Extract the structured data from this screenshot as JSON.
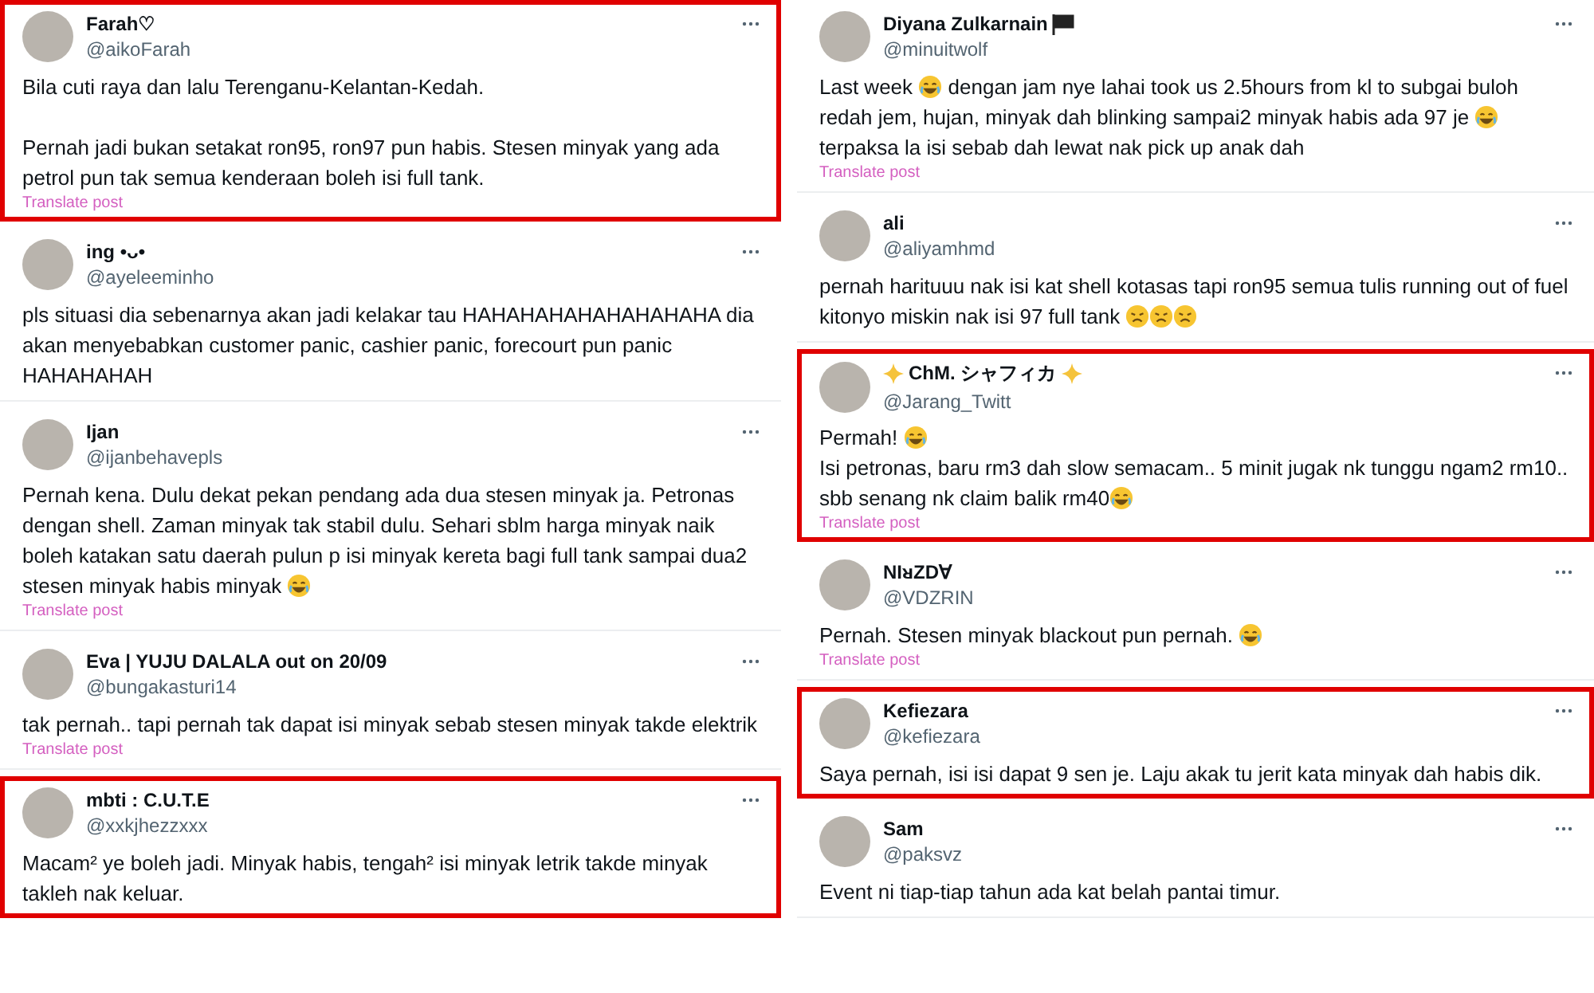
{
  "columns": [
    {
      "posts": [
        {
          "name": [
            {
              "kind": "text",
              "text": "Farah♡"
            }
          ],
          "handle": "@aikoFarah",
          "highlighted": true,
          "translate": "Translate post",
          "body": [
            {
              "kind": "text",
              "text": "Bila cuti raya dan lalu Terenganu-Kelantan-Kedah.\n\nPernah jadi bukan setakat ron95, ron97 pun habis. Stesen minyak yang ada petrol pun tak semua kenderaan boleh isi full tank."
            }
          ]
        },
        {
          "name": [
            {
              "kind": "text",
              "text": "ing •ᴗ•"
            }
          ],
          "handle": "@ayeleeminho",
          "highlighted": false,
          "body": [
            {
              "kind": "text",
              "text": "pls situasi dia sebenarnya akan jadi kelakar tau HAHAHAHAHAHAHAHAHA dia akan menyebabkan customer panic, cashier panic, forecourt pun panic HAHAHAHAH"
            }
          ]
        },
        {
          "name": [
            {
              "kind": "text",
              "text": "Ijan"
            }
          ],
          "handle": "@ijanbehavepls",
          "highlighted": false,
          "translate": "Translate post",
          "body": [
            {
              "kind": "text",
              "text": "Pernah kena. Dulu dekat pekan pendang ada dua stesen minyak ja. Petronas dengan shell. Zaman minyak tak stabil dulu. Sehari sblm harga minyak naik boleh katakan satu daerah pulun p isi minyak kereta bagi full tank sampai dua2 stesen minyak habis minyak "
            },
            {
              "kind": "rofl"
            }
          ]
        },
        {
          "name": [
            {
              "kind": "text",
              "text": "Eva | YUJU DALALA out on 20/09"
            }
          ],
          "handle": "@bungakasturi14",
          "highlighted": false,
          "translate": "Translate post",
          "body": [
            {
              "kind": "text",
              "text": "tak pernah.. tapi pernah tak dapat isi minyak sebab stesen minyak takde elektrik"
            }
          ]
        },
        {
          "name": [
            {
              "kind": "text",
              "text": "mbti : C.U.T.E"
            }
          ],
          "handle": "@xxkjhezzxxx",
          "highlighted": true,
          "body": [
            {
              "kind": "text",
              "text": "Macam² ye boleh jadi. Minyak habis, tengah² isi minyak letrik takde minyak takleh nak keluar."
            }
          ]
        }
      ]
    },
    {
      "posts": [
        {
          "name": [
            {
              "kind": "text",
              "text": "Diyana Zulkarnain"
            },
            {
              "kind": "flag"
            }
          ],
          "handle": "@minuitwolf",
          "highlighted": false,
          "translate": "Translate post",
          "body": [
            {
              "kind": "text",
              "text": "Last week "
            },
            {
              "kind": "laugh"
            },
            {
              "kind": "text",
              "text": " dengan jam nye lahai took us 2.5hours from kl to subgai buloh redah jem, hujan, minyak dah blinking sampai2 minyak habis ada 97 je "
            },
            {
              "kind": "laugh"
            },
            {
              "kind": "text",
              "text": " terpaksa la isi sebab dah lewat nak pick up anak dah"
            }
          ]
        },
        {
          "name": [
            {
              "kind": "text",
              "text": "ali"
            }
          ],
          "handle": "@aliyamhmd",
          "highlighted": false,
          "body": [
            {
              "kind": "text",
              "text": "pernah harituuu nak isi kat shell kotasas tapi ron95 semua tulis running out of fuel kitonyo miskin nak isi 97 full tank "
            },
            {
              "kind": "tired"
            },
            {
              "kind": "tired"
            },
            {
              "kind": "tired"
            }
          ]
        },
        {
          "name": [
            {
              "kind": "sparkle"
            },
            {
              "kind": "text",
              "text": "ChM. シャフィカ"
            },
            {
              "kind": "sparkle"
            }
          ],
          "handle": "@Jarang_Twitt",
          "highlighted": true,
          "translate": "Translate post",
          "body": [
            {
              "kind": "text",
              "text": "Permah! "
            },
            {
              "kind": "sob"
            },
            {
              "kind": "text",
              "text": "\nIsi petronas, baru rm3 dah slow semacam.. 5 minit jugak nk tunggu ngam2 rm10.. sbb senang nk claim balik rm40"
            },
            {
              "kind": "sob"
            }
          ]
        },
        {
          "name": [
            {
              "kind": "text",
              "text": "NIᴚZD∀"
            }
          ],
          "handle": "@VDZRIN",
          "highlighted": false,
          "translate": "Translate post",
          "body": [
            {
              "kind": "text",
              "text": "Pernah. Stesen minyak blackout pun pernah. "
            },
            {
              "kind": "laugh"
            }
          ]
        },
        {
          "name": [
            {
              "kind": "text",
              "text": "Kefiezara"
            }
          ],
          "handle": "@kefiezara",
          "highlighted": true,
          "body": [
            {
              "kind": "text",
              "text": "Saya pernah, isi isi dapat 9 sen je. Laju akak tu jerit kata minyak dah habis dik."
            }
          ]
        },
        {
          "name": [
            {
              "kind": "text",
              "text": "Sam"
            }
          ],
          "handle": "@paksvz",
          "highlighted": false,
          "body": [
            {
              "kind": "text",
              "text": "Event ni tiap-tiap tahun ada kat belah pantai timur."
            }
          ]
        }
      ]
    }
  ]
}
